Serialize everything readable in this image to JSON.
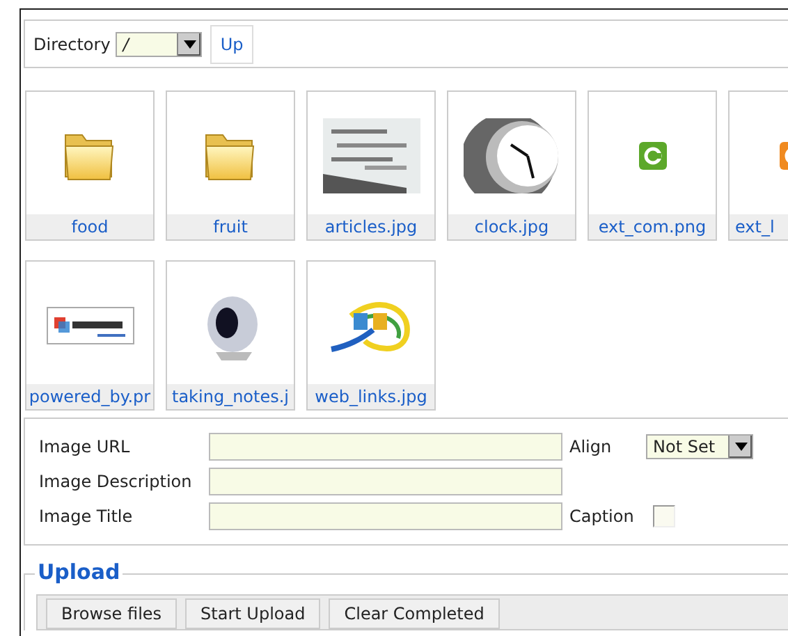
{
  "toolbar": {
    "directory_label": "Directory",
    "directory_value": "/",
    "up_button": "Up"
  },
  "items": [
    {
      "kind": "folder",
      "name": "food"
    },
    {
      "kind": "folder",
      "name": "fruit"
    },
    {
      "kind": "picture",
      "name": "articles.jpg"
    },
    {
      "kind": "picture",
      "name": "clock.jpg"
    },
    {
      "kind": "picture",
      "name": "ext_com.png"
    },
    {
      "kind": "picture",
      "name": "ext_l"
    },
    {
      "kind": "picture",
      "name": "powered_by.pr"
    },
    {
      "kind": "picture",
      "name": "taking_notes.j"
    },
    {
      "kind": "picture",
      "name": "web_links.jpg"
    }
  ],
  "form": {
    "image_url_label": "Image URL",
    "image_description_label": "Image Description",
    "image_title_label": "Image Title",
    "align_label": "Align",
    "align_value": "Not Set",
    "caption_label": "Caption",
    "caption_checked": false
  },
  "upload": {
    "legend": "Upload",
    "buttons": [
      "Browse files",
      "Start Upload",
      "Clear Completed"
    ]
  }
}
